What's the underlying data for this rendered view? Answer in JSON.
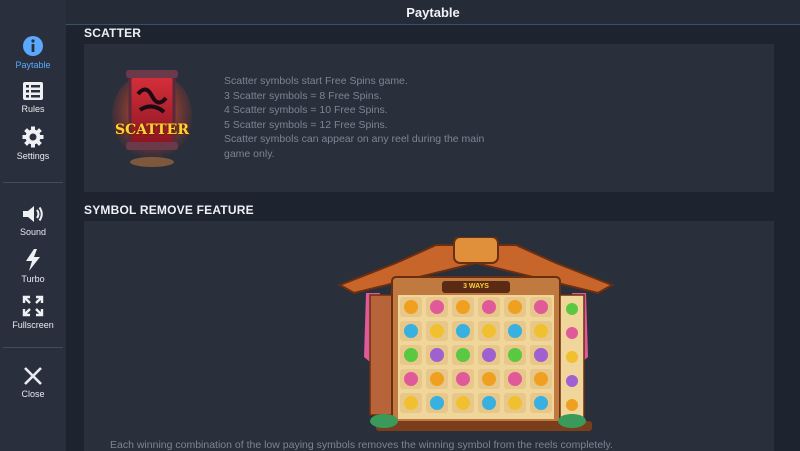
{
  "header": {
    "title": "Paytable"
  },
  "sidebar": {
    "items": [
      {
        "label": "Paytable",
        "icon": "info-icon"
      },
      {
        "label": "Rules",
        "icon": "list-icon"
      },
      {
        "label": "Settings",
        "icon": "gear-icon"
      },
      {
        "label": "Sound",
        "icon": "speaker-icon"
      },
      {
        "label": "Turbo",
        "icon": "lightning-icon"
      },
      {
        "label": "Fullscreen",
        "icon": "expand-icon"
      },
      {
        "label": "Close",
        "icon": "close-icon"
      }
    ],
    "active_color": "#5aa9ff"
  },
  "scatter": {
    "title": "SCATTER",
    "symbol_text": "SCATTER",
    "lines": [
      "Scatter symbols start Free Spins game.",
      "3 Scatter symbols = 8 Free Spins.",
      "4 Scatter symbols = 10 Free Spins.",
      "5 Scatter symbols = 12 Free Spins.",
      "Scatter symbols can appear on any reel during the main",
      "game only."
    ]
  },
  "symbol_remove": {
    "title": "SYMBOL REMOVE FEATURE",
    "sign_text": "3 WAYS",
    "description": "Each winning combination of the low paying symbols removes the winning symbol from the reels completely."
  }
}
